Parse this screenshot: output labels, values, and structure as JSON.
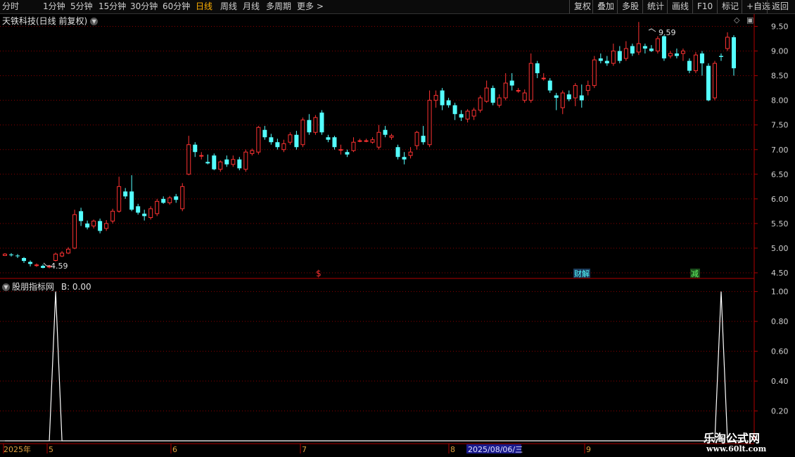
{
  "toolbar": {
    "periods": [
      {
        "label": "分时"
      },
      {
        "label": "1分钟"
      },
      {
        "label": "5分钟"
      },
      {
        "label": "15分钟"
      },
      {
        "label": "30分钟"
      },
      {
        "label": "60分钟"
      },
      {
        "label": "日线"
      },
      {
        "label": "周线"
      },
      {
        "label": "月线"
      },
      {
        "label": "多周期"
      },
      {
        "label": "更多 >"
      }
    ],
    "active_period": "日线",
    "right": [
      {
        "label": "复权"
      },
      {
        "label": "叠加"
      },
      {
        "label": "多股"
      },
      {
        "label": "统计"
      },
      {
        "label": "画线"
      },
      {
        "label": "F10"
      },
      {
        "label": "标记"
      },
      {
        "label": "+自选"
      },
      {
        "label": "返回"
      }
    ]
  },
  "main_panel": {
    "title": "天铁科技(日线 前复权)",
    "high_label": "9.59",
    "low_label": "4.59",
    "markers": [
      "$",
      "财解",
      "减"
    ],
    "y_ticks": [
      "9.50",
      "9.00",
      "8.50",
      "8.00",
      "7.50",
      "7.00",
      "6.50",
      "6.00",
      "5.50",
      "5.00",
      "4.50"
    ]
  },
  "sub_panel": {
    "title": "股朋指标网",
    "value_text": "B: 0.00",
    "y_ticks": [
      "1.00",
      "0.80",
      "0.60",
      "0.40",
      "0.20"
    ]
  },
  "x_axis": {
    "labels": [
      "2025年",
      "5",
      "6",
      "7",
      "8",
      "9"
    ],
    "cursor_date": "2025/08/06/三"
  },
  "watermark": {
    "line1": "乐淘公式网",
    "line2": "www.60lt.com"
  },
  "colors": {
    "up": "#ff3232",
    "down": "#54ffff",
    "grid": "#8b0000",
    "axis": "#b00000",
    "active": "#ffb000"
  },
  "chart_data": {
    "type": "candlestick",
    "title": "天铁科技(日线 前复权)",
    "ylim": [
      4.4,
      9.75
    ],
    "high": 9.59,
    "low": 4.59,
    "candles": [
      [
        4.85,
        4.88,
        4.84,
        4.9
      ],
      [
        4.87,
        4.86,
        4.83,
        4.9
      ],
      [
        4.85,
        4.84,
        4.8,
        4.88
      ],
      [
        4.8,
        4.74,
        4.7,
        4.82
      ],
      [
        4.72,
        4.68,
        4.63,
        4.75
      ],
      [
        4.66,
        4.66,
        4.62,
        4.69
      ],
      [
        4.64,
        4.6,
        4.59,
        4.67
      ],
      [
        4.62,
        4.63,
        4.59,
        4.66
      ],
      [
        4.75,
        4.88,
        4.73,
        4.91
      ],
      [
        4.84,
        4.9,
        4.82,
        4.94
      ],
      [
        4.9,
        4.98,
        4.88,
        5.02
      ],
      [
        5.0,
        5.68,
        4.98,
        5.78
      ],
      [
        5.75,
        5.55,
        5.45,
        5.82
      ],
      [
        5.5,
        5.42,
        5.38,
        5.56
      ],
      [
        5.45,
        5.55,
        5.4,
        5.58
      ],
      [
        5.55,
        5.35,
        5.3,
        5.6
      ],
      [
        5.4,
        5.5,
        5.35,
        5.57
      ],
      [
        5.55,
        5.75,
        5.5,
        5.8
      ],
      [
        5.75,
        6.25,
        5.72,
        6.45
      ],
      [
        6.15,
        6.05,
        6.0,
        6.22
      ],
      [
        6.15,
        5.78,
        5.75,
        6.48
      ],
      [
        5.85,
        5.72,
        5.68,
        5.9
      ],
      [
        5.7,
        5.65,
        5.56,
        5.78
      ],
      [
        5.62,
        5.8,
        5.58,
        5.85
      ],
      [
        5.7,
        5.95,
        5.65,
        6.0
      ],
      [
        6.0,
        5.92,
        5.9,
        6.05
      ],
      [
        5.92,
        6.02,
        5.88,
        6.06
      ],
      [
        6.05,
        5.98,
        5.92,
        6.1
      ],
      [
        5.8,
        6.25,
        5.75,
        6.32
      ],
      [
        6.5,
        7.1,
        6.48,
        7.28
      ],
      [
        7.1,
        6.95,
        6.85,
        7.15
      ],
      [
        6.88,
        6.88,
        6.8,
        6.95
      ],
      [
        6.75,
        6.72,
        6.7,
        6.9
      ],
      [
        6.88,
        6.6,
        6.58,
        6.92
      ],
      [
        6.6,
        6.75,
        6.55,
        6.78
      ],
      [
        6.8,
        6.7,
        6.65,
        6.88
      ],
      [
        6.7,
        6.8,
        6.65,
        6.88
      ],
      [
        6.8,
        6.62,
        6.58,
        6.85
      ],
      [
        6.6,
        6.95,
        6.55,
        7.0
      ],
      [
        6.92,
        6.98,
        6.88,
        7.02
      ],
      [
        6.95,
        7.45,
        6.9,
        7.48
      ],
      [
        7.4,
        7.25,
        7.2,
        7.48
      ],
      [
        7.25,
        7.15,
        7.1,
        7.32
      ],
      [
        7.15,
        7.05,
        7.0,
        7.22
      ],
      [
        7.0,
        7.12,
        6.95,
        7.2
      ],
      [
        7.15,
        7.3,
        7.1,
        7.35
      ],
      [
        7.3,
        7.05,
        7.0,
        7.38
      ],
      [
        7.1,
        7.6,
        7.05,
        7.65
      ],
      [
        7.6,
        7.35,
        7.3,
        7.72
      ],
      [
        7.35,
        7.65,
        7.3,
        7.7
      ],
      [
        7.75,
        7.35,
        7.3,
        7.8
      ],
      [
        7.25,
        7.2,
        7.15,
        7.3
      ],
      [
        7.25,
        7.05,
        7.0,
        7.28
      ],
      [
        7.0,
        7.0,
        6.9,
        7.1
      ],
      [
        6.95,
        6.9,
        6.85,
        7.0
      ],
      [
        6.98,
        7.15,
        6.95,
        7.25
      ],
      [
        7.18,
        7.18,
        7.15,
        7.22
      ],
      [
        7.18,
        7.18,
        7.15,
        7.22
      ],
      [
        7.15,
        7.2,
        7.12,
        7.25
      ],
      [
        7.05,
        7.35,
        7.0,
        7.5
      ],
      [
        7.4,
        7.3,
        7.25,
        7.48
      ],
      [
        7.25,
        7.28,
        7.2,
        7.32
      ],
      [
        7.05,
        6.85,
        6.8,
        7.1
      ],
      [
        6.85,
        6.8,
        6.7,
        6.95
      ],
      [
        6.88,
        6.95,
        6.82,
        7.05
      ],
      [
        7.08,
        7.35,
        7.0,
        7.38
      ],
      [
        7.28,
        7.15,
        7.1,
        7.48
      ],
      [
        7.1,
        8.0,
        7.05,
        8.2
      ],
      [
        8.0,
        8.1,
        7.85,
        8.2
      ],
      [
        8.2,
        7.9,
        7.8,
        8.25
      ],
      [
        8.0,
        7.9,
        7.85,
        8.05
      ],
      [
        7.9,
        7.72,
        7.6,
        7.95
      ],
      [
        7.72,
        7.65,
        7.58,
        7.8
      ],
      [
        7.62,
        7.78,
        7.55,
        7.82
      ],
      [
        7.68,
        7.8,
        7.6,
        7.85
      ],
      [
        7.8,
        8.05,
        7.75,
        8.1
      ],
      [
        7.98,
        8.25,
        7.95,
        8.4
      ],
      [
        8.25,
        7.95,
        7.9,
        8.3
      ],
      [
        7.9,
        8.05,
        7.85,
        8.12
      ],
      [
        8.05,
        8.35,
        8.0,
        8.55
      ],
      [
        8.4,
        8.3,
        8.2,
        8.55
      ],
      [
        8.2,
        8.2,
        8.15,
        8.25
      ],
      [
        8.0,
        8.15,
        7.95,
        8.22
      ],
      [
        8.0,
        8.75,
        7.95,
        8.95
      ],
      [
        8.75,
        8.55,
        8.45,
        8.8
      ],
      [
        8.45,
        8.45,
        8.4,
        8.55
      ],
      [
        8.4,
        8.2,
        8.15,
        8.45
      ],
      [
        8.1,
        8.05,
        7.8,
        8.15
      ],
      [
        7.85,
        8.15,
        7.72,
        8.2
      ],
      [
        8.12,
        8.02,
        7.98,
        8.2
      ],
      [
        8.05,
        8.3,
        7.88,
        8.35
      ],
      [
        8.1,
        8.0,
        7.85,
        8.32
      ],
      [
        8.2,
        8.3,
        8.1,
        8.4
      ],
      [
        8.3,
        8.82,
        8.25,
        8.9
      ],
      [
        8.85,
        8.8,
        8.75,
        8.95
      ],
      [
        8.8,
        8.75,
        8.7,
        8.9
      ],
      [
        8.75,
        9.0,
        8.7,
        9.15
      ],
      [
        9.0,
        8.8,
        8.75,
        9.1
      ],
      [
        8.85,
        9.05,
        8.8,
        9.2
      ],
      [
        9.1,
        8.95,
        8.9,
        9.15
      ],
      [
        8.98,
        9.15,
        8.92,
        9.59
      ],
      [
        9.1,
        9.05,
        8.95,
        9.15
      ],
      [
        9.05,
        9.0,
        8.98,
        9.12
      ],
      [
        9.0,
        9.25,
        8.95,
        9.3
      ],
      [
        9.3,
        8.85,
        8.8,
        9.32
      ],
      [
        8.9,
        8.95,
        8.85,
        9.0
      ],
      [
        8.95,
        8.9,
        8.85,
        9.05
      ],
      [
        8.95,
        9.0,
        8.8,
        9.05
      ],
      [
        8.8,
        8.6,
        8.55,
        8.85
      ],
      [
        8.6,
        8.92,
        8.55,
        8.98
      ],
      [
        8.95,
        8.75,
        8.5,
        9.0
      ],
      [
        8.7,
        8.0,
        7.98,
        8.75
      ],
      [
        8.05,
        8.75,
        8.0,
        8.8
      ],
      [
        8.9,
        8.88,
        8.8,
        8.95
      ],
      [
        9.05,
        9.28,
        9.0,
        9.38
      ],
      [
        9.28,
        8.65,
        8.5,
        9.32
      ]
    ],
    "indicator": {
      "name": "股朋指标网",
      "series": "B",
      "ylim": [
        0,
        1.05
      ],
      "values": [
        0,
        0,
        0,
        0,
        0,
        0,
        0,
        0,
        1,
        0,
        0,
        0,
        0,
        0,
        0,
        0,
        0,
        0,
        0,
        0,
        0,
        0,
        0,
        0,
        0,
        0,
        0,
        0,
        0,
        0,
        0,
        0,
        0,
        0,
        0,
        0,
        0,
        0,
        0,
        0,
        0,
        0,
        0,
        0,
        0,
        0,
        0,
        0,
        0,
        0,
        0,
        0,
        0,
        0,
        0,
        0,
        0,
        0,
        0,
        0,
        0,
        0,
        0,
        0,
        0,
        0,
        0,
        0,
        0,
        0,
        0,
        0,
        0,
        0,
        0,
        0,
        0,
        0,
        0,
        0,
        0,
        0,
        0,
        0,
        0,
        0,
        0,
        0,
        0,
        0,
        0,
        0,
        0,
        0,
        0,
        0,
        0,
        0,
        0,
        0,
        0,
        0,
        0,
        0,
        0,
        0,
        0,
        0,
        0,
        0,
        0,
        0,
        0,
        1,
        0,
        0,
        0,
        0
      ]
    }
  }
}
